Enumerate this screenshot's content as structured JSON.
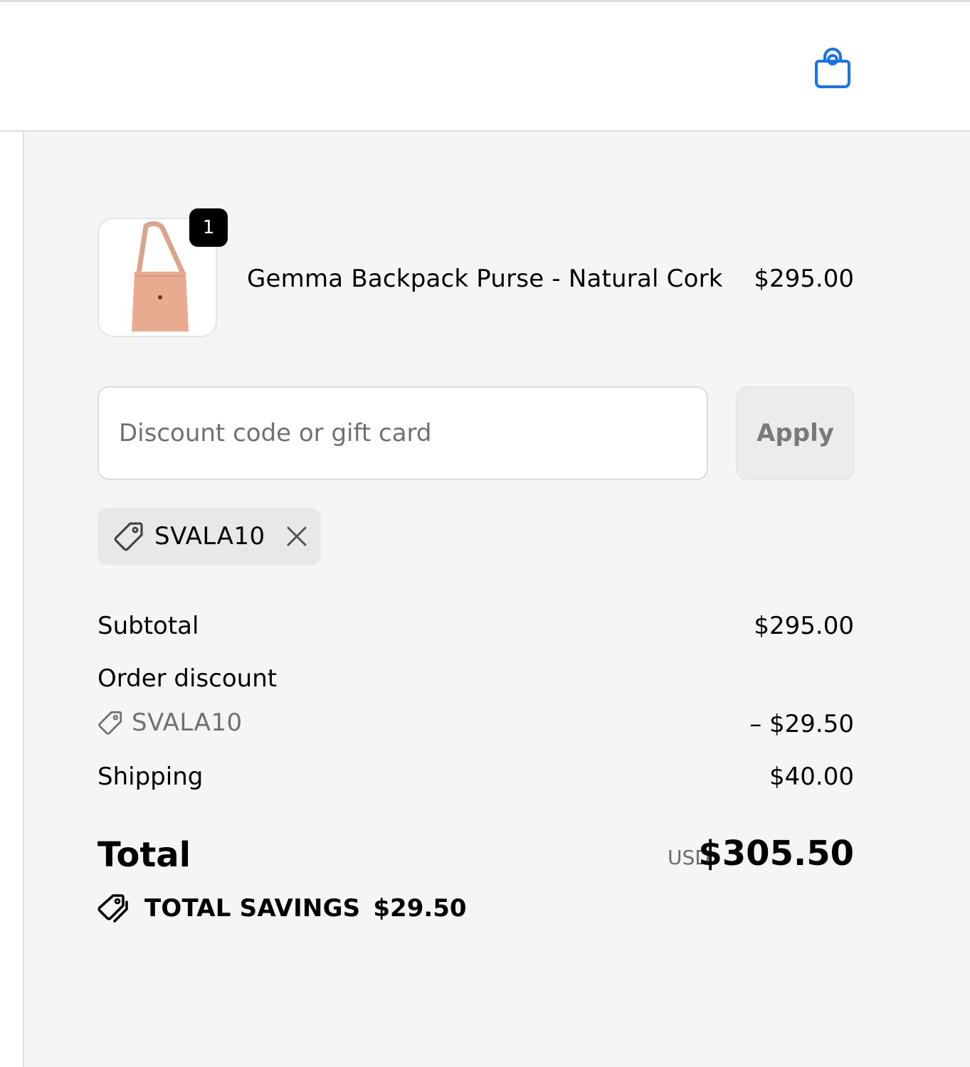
{
  "header": {
    "cart_icon": "shopping-bag-icon",
    "accent_color": "#1773e6"
  },
  "line_item": {
    "quantity": "1",
    "name": "Gemma Backpack Purse - Natural Cork",
    "price": "$295.00",
    "image_icon": "bag-product-image"
  },
  "discount": {
    "placeholder": "Discount code or gift card",
    "value": "",
    "apply_label": "Apply",
    "applied_code": "SVALA10",
    "tag_icon": "tag-icon",
    "remove_icon": "close-icon"
  },
  "totals": {
    "subtotal_label": "Subtotal",
    "subtotal_value": "$295.00",
    "order_discount_label": "Order discount",
    "order_discount_code": "SVALA10",
    "order_discount_value": "– $29.50",
    "shipping_label": "Shipping",
    "shipping_value": "$40.00",
    "total_label": "Total",
    "currency": "USD",
    "total_value": "$305.50",
    "savings_label": "TOTAL SAVINGS",
    "savings_value": "$29.50"
  }
}
